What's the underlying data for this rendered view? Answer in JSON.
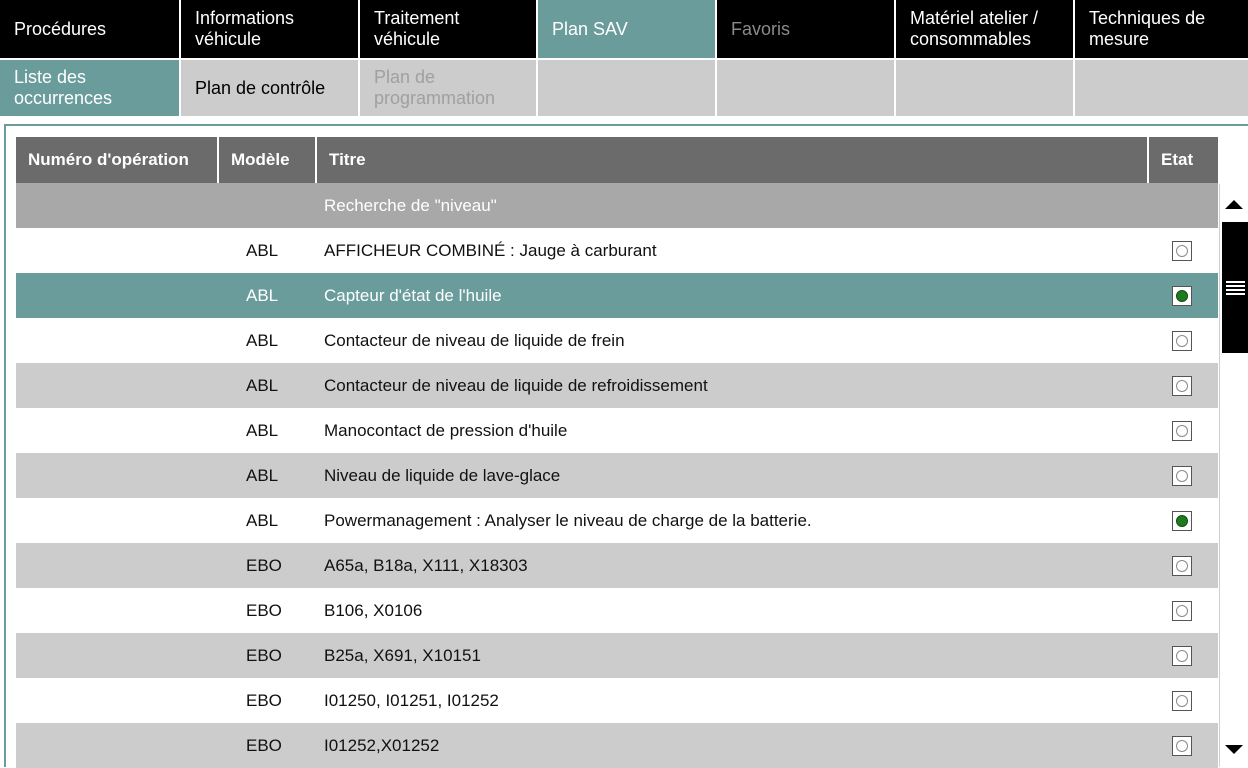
{
  "tabs_top": [
    {
      "label": "Procédures",
      "state": "normal"
    },
    {
      "label": "Informations véhicule",
      "state": "normal"
    },
    {
      "label": "Traitement véhicule",
      "state": "normal"
    },
    {
      "label": "Plan SAV",
      "state": "active"
    },
    {
      "label": "Favoris",
      "state": "disabled"
    },
    {
      "label": "Matériel atelier / consommables",
      "state": "normal"
    },
    {
      "label": "Techniques de mesure",
      "state": "normal"
    }
  ],
  "tabs_sub": [
    {
      "label": "Liste des occurrences",
      "state": "active"
    },
    {
      "label": "Plan de contrôle",
      "state": "normal"
    },
    {
      "label": "Plan de programmation",
      "state": "disabled"
    },
    {
      "label": "",
      "state": "empty"
    },
    {
      "label": "",
      "state": "empty"
    },
    {
      "label": "",
      "state": "empty"
    },
    {
      "label": "",
      "state": "empty"
    }
  ],
  "table": {
    "columns": [
      "Numéro d'opération",
      "Modèle",
      "Titre",
      "Etat"
    ],
    "search_label": "Recherche de \"niveau\"",
    "rows": [
      {
        "operation": "",
        "model": "ABL",
        "title": "AFFICHEUR COMBINÉ : Jauge à carburant",
        "done": false
      },
      {
        "operation": "",
        "model": "ABL",
        "title": "Capteur d'état de l'huile",
        "done": true,
        "selected": true
      },
      {
        "operation": "",
        "model": "ABL",
        "title": "Contacteur de niveau de liquide de frein",
        "done": false
      },
      {
        "operation": "",
        "model": "ABL",
        "title": "Contacteur de niveau de liquide de refroidissement",
        "done": false
      },
      {
        "operation": "",
        "model": "ABL",
        "title": "Manocontact de pression d'huile",
        "done": false
      },
      {
        "operation": "",
        "model": "ABL",
        "title": "Niveau de liquide de lave-glace",
        "done": false
      },
      {
        "operation": "",
        "model": "ABL",
        "title": "Powermanagement : Analyser le niveau de charge de la batterie.",
        "done": true
      },
      {
        "operation": "",
        "model": "EBO",
        "title": "A65a, B18a, X111, X18303",
        "done": false
      },
      {
        "operation": "",
        "model": "EBO",
        "title": "B106, X0106",
        "done": false
      },
      {
        "operation": "",
        "model": "EBO",
        "title": "B25a, X691, X10151",
        "done": false
      },
      {
        "operation": "",
        "model": "EBO",
        "title": "I01250, I01251, I01252",
        "done": false
      },
      {
        "operation": "",
        "model": "EBO",
        "title": "I01252,X01252",
        "done": false
      }
    ]
  },
  "scrollbar": {
    "up_icon": "arrow-up-icon",
    "down_icon": "arrow-down-icon",
    "grip_icon": "grip-lines-icon"
  },
  "colors": {
    "active_tab": "#6a9c9c",
    "tab_bg": "#000000",
    "header_bg": "#6b6b6b",
    "row_alt": "#cccccc",
    "status_done": "#1e7a1e"
  }
}
